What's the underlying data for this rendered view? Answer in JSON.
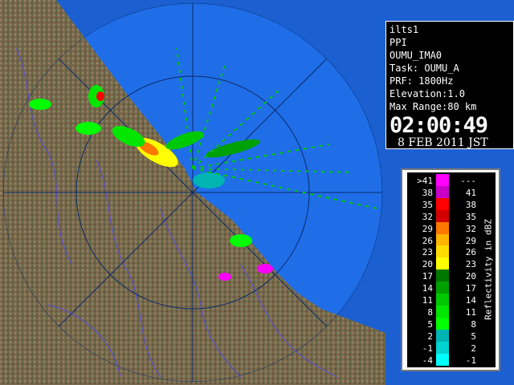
{
  "header": {
    "station": "ilts1",
    "scan_type": "PPI",
    "site": "OUMU_IMA0",
    "task": "Task: OUMU_A",
    "prf": "PRF: 1800Hz",
    "elevation": "Elevation:1.0",
    "max_range": "Max Range:80 km",
    "time": "02:00:49",
    "date": "8 FEB 2011 JST"
  },
  "legend": {
    "unit_label": "Reflectivity in dBZ",
    "bins": [
      {
        "low": ">41",
        "high": "---",
        "color": "#ff00ff"
      },
      {
        "low": "38",
        "high": "41",
        "color": "#c800c8"
      },
      {
        "low": "35",
        "high": "38",
        "color": "#ff0000"
      },
      {
        "low": "32",
        "high": "35",
        "color": "#d20000"
      },
      {
        "low": "29",
        "high": "32",
        "color": "#ff7800"
      },
      {
        "low": "26",
        "high": "29",
        "color": "#ffb400"
      },
      {
        "low": "23",
        "high": "26",
        "color": "#ffdc00"
      },
      {
        "low": "20",
        "high": "23",
        "color": "#ffff00"
      },
      {
        "low": "17",
        "high": "20",
        "color": "#007800"
      },
      {
        "low": "14",
        "high": "17",
        "color": "#00a000"
      },
      {
        "low": "11",
        "high": "14",
        "color": "#00c800"
      },
      {
        "low": "8",
        "high": "11",
        "color": "#00e600"
      },
      {
        "low": "5",
        "high": "8",
        "color": "#00ff00"
      },
      {
        "low": "2",
        "high": "5",
        "color": "#00b4b4"
      },
      {
        "low": "-1",
        "high": "2",
        "color": "#00d2d2"
      },
      {
        "low": "-4",
        "high": "-1",
        "color": "#00ffff"
      }
    ]
  },
  "colors": {
    "sea": "#1f6ee8",
    "outer_sea": "#1b5fd0",
    "land": "#7a6a4e",
    "river": "#5a50c8"
  }
}
